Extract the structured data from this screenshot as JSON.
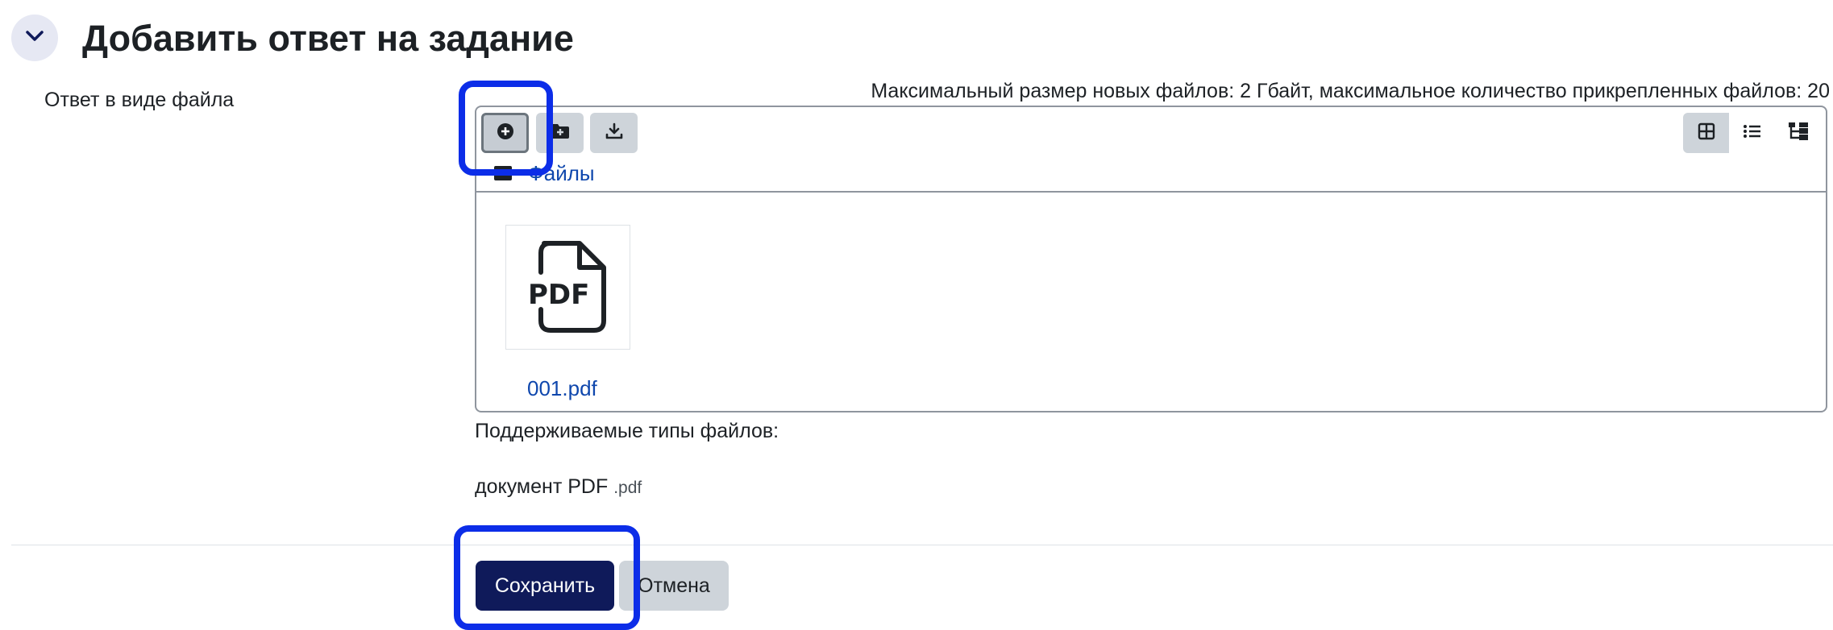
{
  "section": {
    "title": "Добавить ответ на задание",
    "collapse_icon": "chevron-down-icon"
  },
  "field": {
    "label": "Ответ в виде файла",
    "limits_text": "Максимальный размер новых файлов: 2 Гбайт, максимальное количество прикрепленных файлов: 20"
  },
  "filemanager": {
    "toolbar": {
      "buttons": [
        "add-file-icon",
        "create-folder-icon",
        "download-icon"
      ],
      "views": [
        "grid-view-icon",
        "list-view-icon",
        "tree-view-icon"
      ],
      "selected_view": "grid-view-icon"
    },
    "path_label": "Файлы",
    "files": [
      {
        "name": "001.pdf",
        "icon": "pdf-file-icon",
        "icon_text": "PDF"
      }
    ]
  },
  "supported": {
    "label": "Поддерживаемые типы файлов:",
    "type_name": "документ PDF",
    "type_ext": ".pdf"
  },
  "actions": {
    "save_label": "Сохранить",
    "cancel_label": "Отмена"
  },
  "colors": {
    "primary": "#0f1a5a",
    "link": "#0f47ad",
    "highlight": "#0c2de8",
    "button_gray": "#ced4da"
  }
}
